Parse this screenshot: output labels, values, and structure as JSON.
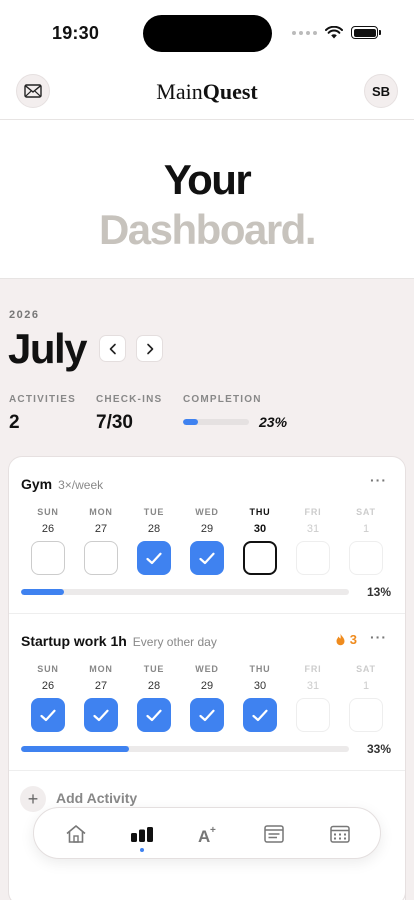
{
  "status": {
    "time": "19:30"
  },
  "header": {
    "brand_light": "Main",
    "brand_bold": "Quest",
    "avatar_initials": "SB"
  },
  "hero": {
    "line1": "Your",
    "line2": "Dashboard."
  },
  "calendar": {
    "year": "2026",
    "month": "July"
  },
  "stats": {
    "activities_label": "ACTIVITIES",
    "activities_value": "2",
    "checkins_label": "CHECK-INS",
    "checkins_value": "7/30",
    "completion_label": "COMPLETION",
    "completion_value": "23%",
    "completion_fraction": 0.23
  },
  "day_names": [
    "SUN",
    "MON",
    "TUE",
    "WED",
    "THU",
    "FRI",
    "SAT"
  ],
  "day_numbers": [
    "26",
    "27",
    "28",
    "29",
    "30",
    "31",
    "1"
  ],
  "activities": [
    {
      "name": "Gym",
      "frequency": "3×/week",
      "streak": "",
      "states": [
        "empty",
        "empty",
        "checked",
        "checked",
        "today",
        "future",
        "future"
      ],
      "progress_label": "13%",
      "progress_fraction": 0.13,
      "more": "···"
    },
    {
      "name": "Startup work 1h",
      "frequency": "Every other day",
      "streak": "3",
      "states": [
        "checked",
        "checked",
        "checked",
        "checked",
        "checked",
        "future",
        "future"
      ],
      "progress_label": "33%",
      "progress_fraction": 0.33,
      "more": "···"
    }
  ],
  "add_activity": {
    "icon": "plus-icon",
    "label": "Add Activity"
  },
  "tabs": [
    {
      "icon": "home-icon",
      "active": false
    },
    {
      "icon": "stats-icon",
      "active": true
    },
    {
      "icon": "font-icon",
      "active": false
    },
    {
      "icon": "notes-icon",
      "active": false
    },
    {
      "icon": "calendar-icon",
      "active": false
    }
  ],
  "colors": {
    "accent": "#3f82f0",
    "streak": "#ef8b1e",
    "muted_heading": "#c7c3bd",
    "background": "#f4efef"
  }
}
